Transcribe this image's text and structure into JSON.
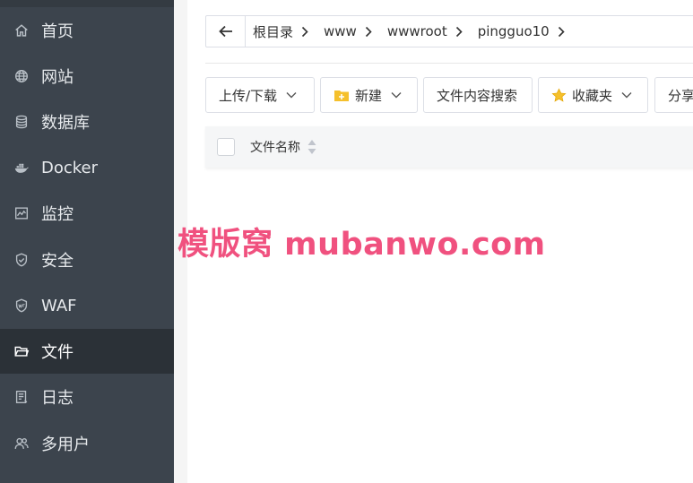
{
  "sidebar": {
    "items": [
      {
        "label": "首页",
        "icon": "home-icon",
        "active": false
      },
      {
        "label": "网站",
        "icon": "globe-icon",
        "active": false
      },
      {
        "label": "数据库",
        "icon": "database-icon",
        "active": false
      },
      {
        "label": "Docker",
        "icon": "docker-icon",
        "active": false
      },
      {
        "label": "监控",
        "icon": "monitor-icon",
        "active": false
      },
      {
        "label": "安全",
        "icon": "shield-icon",
        "active": false
      },
      {
        "label": "WAF",
        "icon": "waf-shield-icon",
        "active": false
      },
      {
        "label": "文件",
        "icon": "folder-icon",
        "active": true
      },
      {
        "label": "日志",
        "icon": "log-icon",
        "active": false
      },
      {
        "label": "多用户",
        "icon": "users-icon",
        "active": false
      }
    ]
  },
  "breadcrumb": {
    "items": [
      "根目录",
      "www",
      "wwwroot",
      "pingguo10"
    ]
  },
  "toolbar": {
    "upload_label": "上传/下载",
    "new_label": "新建",
    "search_label": "文件内容搜索",
    "favorites_label": "收藏夹",
    "share_label": "分享"
  },
  "table": {
    "col_name": "文件名称"
  },
  "watermark": {
    "text": "模版窝 mubanwo.com"
  },
  "colors": {
    "sidebar_bg": "#3c444d",
    "sidebar_active": "#2b3137",
    "watermark": "#f0517f",
    "folder_yellow": "#f5c02c"
  }
}
